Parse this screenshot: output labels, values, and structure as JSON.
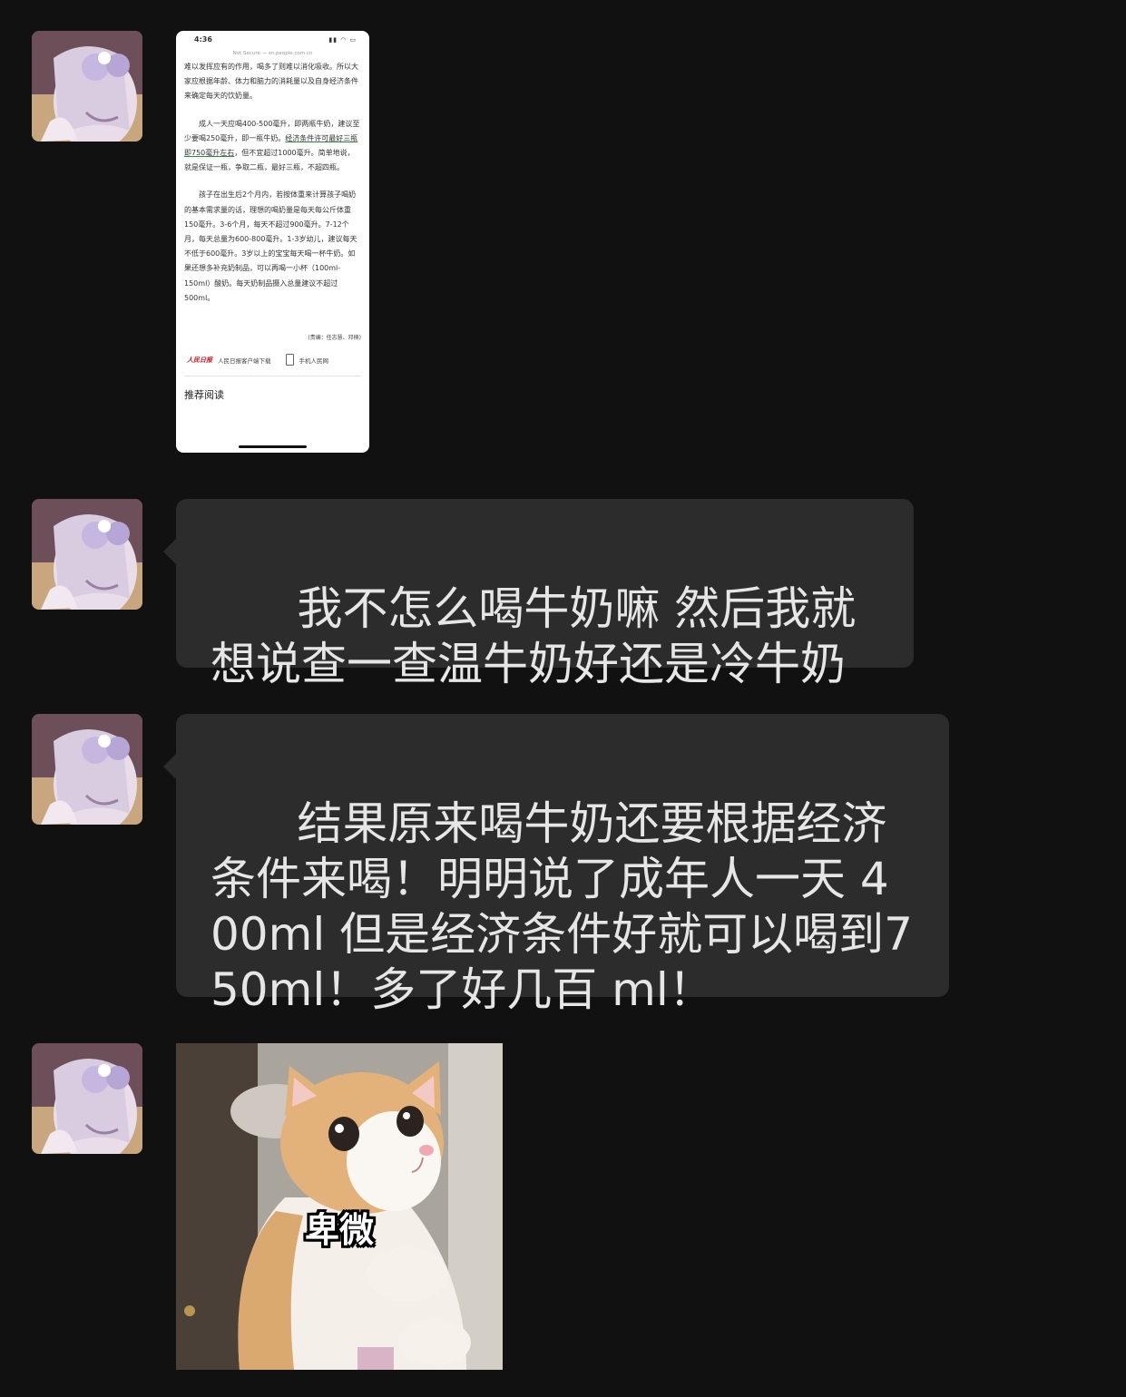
{
  "messages": [
    {
      "type": "image",
      "avatar_icon": "anime-girl-avatar-icon",
      "screenshot": {
        "time": "4:36",
        "status_icons": "signal wifi battery",
        "url_bar": "Not Secure — sn.people.com.cn",
        "paragraph_1": "难以发挥应有的作用，喝多了则难以消化吸收。所以大家应根据年龄、体力和脑力的消耗量以及自身经济条件来确定每天的饮奶量。",
        "paragraph_2_a": "　　成人一天应喝400-500毫升，即两瓶牛奶，建议至少要喝250毫升，即一瓶牛奶。",
        "paragraph_2_highlight": "经济条件许可最好三瓶即750毫升左右",
        "paragraph_2_b": "，但不宜超过1000毫升。简单地说，就是保证一瓶，争取二瓶，最好三瓶，不超四瓶。",
        "paragraph_3": "　　孩子在出生后2个月内，若按体重来计算孩子喝奶的基本需求量的话，理想的喝奶量是每天每公斤体重150毫升。3-6个月，每天不超过900毫升。7-12个月，每天总量为600-800毫升。1-3岁幼儿，建议每天不低于600毫升。3岁以上的宝宝每天喝一杯牛奶。如果还想多补充奶制品，可以再喝一小杯（100ml-150ml）酸奶。每天奶制品摄入总量建议不超过500ml。",
        "editor": "(责编：任志慧、邓楠)",
        "logo_text": "人民日报",
        "link_1": "人民日报客户端下载",
        "link_2": "手机人民网",
        "recommend": "推荐阅读"
      }
    },
    {
      "type": "text",
      "avatar_icon": "anime-girl-avatar-icon",
      "text": "我不怎么喝牛奶嘛 然后我就想说查一查温牛奶好还是冷牛奶"
    },
    {
      "type": "text",
      "avatar_icon": "anime-girl-avatar-icon",
      "text": "结果原来喝牛奶还要根据经济条件来喝！明明说了成年人一天 400ml 但是经济条件好就可以喝到750ml！多了好几百 ml！"
    },
    {
      "type": "sticker",
      "avatar_icon": "anime-girl-avatar-icon",
      "sticker_icon": "cat-sticker-icon",
      "caption": "卑微"
    }
  ],
  "colors": {
    "background": "#111111",
    "bubble": "#2c2c2c",
    "bubble_text": "#e6e6e6",
    "highlight_underline": "#2d8c3c"
  }
}
